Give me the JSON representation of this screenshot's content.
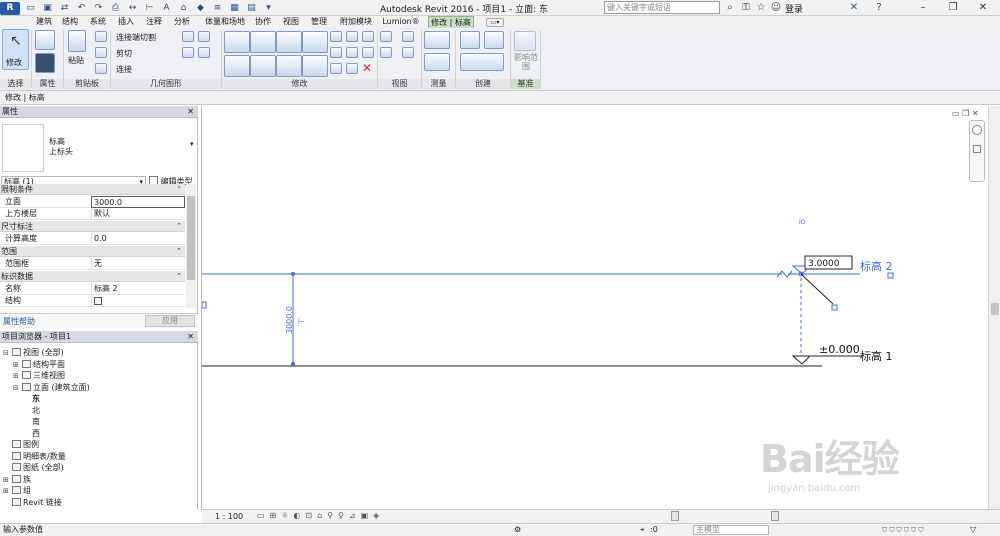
{
  "app_title": "Autodesk Revit 2016 -    项目1 - 立面: 东",
  "search_placeholder": "键入关键字或短语",
  "login_label": "登录",
  "tabs": [
    "建筑",
    "结构",
    "系统",
    "插入",
    "注释",
    "分析",
    "体量和场地",
    "协作",
    "视图",
    "管理",
    "附加模块",
    "Lumion®",
    "修改 | 标高"
  ],
  "ribbon": {
    "modify_label": "修改",
    "paste_label": "粘贴",
    "cut_join_label": "连接端切割",
    "cut_label": "剪切",
    "join_label": "连接",
    "panels": [
      "选择",
      "属性",
      "剪贴板",
      "几何图形",
      "修改",
      "视图",
      "测量",
      "创建",
      "基准"
    ],
    "affect_range": "影响范围"
  },
  "context_bar": "修改 | 标高",
  "properties": {
    "title": "属性",
    "close": "✕",
    "type_family": "标高",
    "type_name": "上标头",
    "selector": "标高 (1)",
    "edit_type": "编辑类型",
    "sections": [
      {
        "name": "限制条件",
        "rows": [
          {
            "k": "立面",
            "v": "3000.0"
          },
          {
            "k": "上方楼层",
            "v": "默认"
          }
        ]
      },
      {
        "name": "尺寸标注",
        "rows": [
          {
            "k": "计算高度",
            "v": "0.0"
          }
        ]
      },
      {
        "name": "范围",
        "rows": [
          {
            "k": "范围框",
            "v": "无"
          }
        ]
      },
      {
        "name": "标识数据",
        "rows": [
          {
            "k": "名称",
            "v": "标高 2"
          },
          {
            "k": "结构",
            "v": ""
          }
        ]
      }
    ],
    "help": "属性帮助",
    "apply": "应用"
  },
  "browser": {
    "title": "项目浏览器 - 项目1",
    "items": [
      {
        "label": "视图 (全部)",
        "level": 0,
        "tog": "⊟"
      },
      {
        "label": "结构平面",
        "level": 1,
        "tog": "⊞"
      },
      {
        "label": "三维视图",
        "level": 1,
        "tog": "⊞"
      },
      {
        "label": "立面 (建筑立面)",
        "level": 1,
        "tog": "⊟"
      },
      {
        "label": "东",
        "level": 2,
        "tog": "",
        "bold": true
      },
      {
        "label": "北",
        "level": 2,
        "tog": ""
      },
      {
        "label": "南",
        "level": 2,
        "tog": ""
      },
      {
        "label": "西",
        "level": 2,
        "tog": ""
      },
      {
        "label": "图例",
        "level": 0,
        "tog": ""
      },
      {
        "label": "明细表/数量",
        "level": 0,
        "tog": ""
      },
      {
        "label": "图纸 (全部)",
        "level": 0,
        "tog": ""
      },
      {
        "label": "族",
        "level": 0,
        "tog": "⊞"
      },
      {
        "label": "组",
        "level": 0,
        "tog": "⊞"
      },
      {
        "label": "Revit 链接",
        "level": 0,
        "tog": ""
      }
    ]
  },
  "canvas": {
    "level2_name": "标高 2",
    "level2_edit_value": "3.0000",
    "level1_name": "标高 1",
    "level1_value": "±0.000",
    "dimension_value": "3000.0",
    "line_color": "#3b6fd8"
  },
  "viewbar": {
    "scale": "1 : 100"
  },
  "status": {
    "prompt": "输入参数值",
    "zero": ":0",
    "model": "主模型"
  },
  "watermark": {
    "brand": "Bai经验",
    "url": "jingyan.baidu.com"
  }
}
